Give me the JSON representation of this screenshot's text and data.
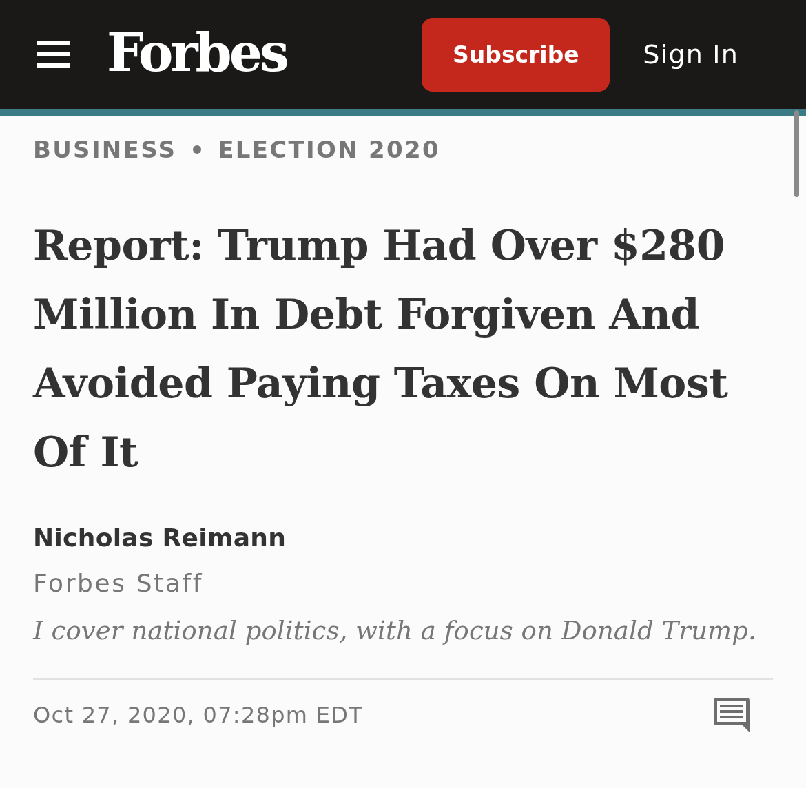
{
  "header": {
    "logo": "Forbes",
    "subscribe_button": "Subscribe",
    "sign_in_link": "Sign In"
  },
  "breadcrumb": [
    "BUSINESS",
    "ELECTION 2020"
  ],
  "article": {
    "title": "Report: Trump Had Over $280 Million In Debt Forgiven And Avoided Paying Taxes On Most Of It",
    "author": {
      "name": "Nicholas Reimann",
      "role": "Forbes Staff",
      "bio": "I cover national politics, with a focus on Donald Trump."
    },
    "date": "Oct 27, 2020, 07:28pm EDT"
  }
}
